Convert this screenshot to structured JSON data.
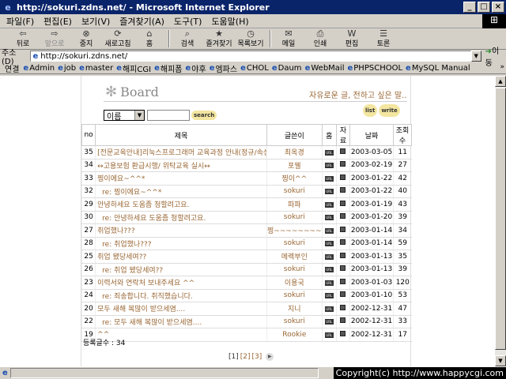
{
  "window": {
    "title": "http://sokuri.zdns.net/ - Microsoft Internet Explorer"
  },
  "menubar": {
    "items": [
      "파일(F)",
      "편집(E)",
      "보기(V)",
      "즐겨찾기(A)",
      "도구(T)",
      "도움말(H)"
    ]
  },
  "toolbar": {
    "back": "뒤로",
    "forward": "앞으로",
    "stop": "중지",
    "refresh": "새로고침",
    "home": "홈",
    "search": "검색",
    "favorites": "즐겨찾기",
    "history": "목록보기",
    "mail": "메일",
    "print": "인쇄",
    "edit": "편집",
    "discuss": "토론"
  },
  "address": {
    "label": "주소(D)",
    "url": "http://sokuri.zdns.net/",
    "go": "이동"
  },
  "links": {
    "label": "연결",
    "items": [
      "Admin",
      "job",
      "master",
      "해피CGI",
      "해피폼",
      "야후",
      "엠파스",
      "CHOL",
      "Daum",
      "WebMail",
      "PHPSCHOOL",
      "MySQL Manual"
    ]
  },
  "board": {
    "title": "Board",
    "slogan": "자유로운 글, 전하고 싶은 말..",
    "search": {
      "field": "이름",
      "button": "search"
    },
    "list_button": "list",
    "write_button": "write",
    "columns": [
      "no",
      "제목",
      "글쓴이",
      "홈",
      "자료",
      "날짜",
      "조회수"
    ],
    "rows": [
      {
        "no": "35",
        "subject": "[전문교육안내]리눅스프로그래머 교육과정 안내(정규/속성)",
        "author": "최옥경",
        "date": "2003-03-05",
        "views": "11"
      },
      {
        "no": "34",
        "subject": "↔고용보험 환급시행/ 위탁교육 실시↔",
        "author": "포웰",
        "date": "2003-02-19",
        "views": "27"
      },
      {
        "no": "33",
        "subject": "찡이에요~^^*",
        "author": "찡이^^",
        "date": "2003-01-22",
        "views": "42"
      },
      {
        "no": "32",
        "subject": "re: 찡이에요~^^*",
        "author": "sokuri",
        "date": "2003-01-22",
        "views": "40"
      },
      {
        "no": "29",
        "subject": "안녕하세요 도움좀 청할려고요.",
        "author": "파파",
        "date": "2003-01-19",
        "views": "43"
      },
      {
        "no": "30",
        "subject": "re: 안녕하세요 도움좀 청할려고요.",
        "author": "sokuri",
        "date": "2003-01-20",
        "views": "39"
      },
      {
        "no": "27",
        "subject": "취업했나???",
        "author": "찡~~~~~~~~",
        "date": "2003-01-14",
        "views": "34"
      },
      {
        "no": "28",
        "subject": "re: 취업했나???",
        "author": "sokuri",
        "date": "2003-01-14",
        "views": "59"
      },
      {
        "no": "25",
        "subject": "취업 됐당세여??",
        "author": "메렉부인",
        "date": "2003-01-13",
        "views": "35"
      },
      {
        "no": "26",
        "subject": "re: 취업 됐당세여??",
        "author": "sokuri",
        "date": "2003-01-13",
        "views": "39"
      },
      {
        "no": "23",
        "subject": "이력서와 연락처 보내주세요 ^^",
        "author": "이용국",
        "date": "2003-01-03",
        "views": "120"
      },
      {
        "no": "24",
        "subject": "re: 죄송합니다. 취직했습니다.",
        "author": "sokuri",
        "date": "2003-01-10",
        "views": "53"
      },
      {
        "no": "20",
        "subject": "모두 새해 복많이 받으세염....",
        "author": "지니",
        "date": "2002-12-31",
        "views": "47"
      },
      {
        "no": "22",
        "subject": "re: 모두 새해 복많이 받으세염....",
        "author": "sokuri",
        "date": "2002-12-31",
        "views": "33"
      },
      {
        "no": "19",
        "subject": "^^",
        "author": "Rookie",
        "date": "2002-12-31",
        "views": "17"
      }
    ],
    "total": "등록글수 : 34",
    "pages": [
      "[1]",
      "[2]",
      "[3]"
    ]
  },
  "status": {
    "copyright": "Copyright(c) http://www.happycgi.com"
  }
}
